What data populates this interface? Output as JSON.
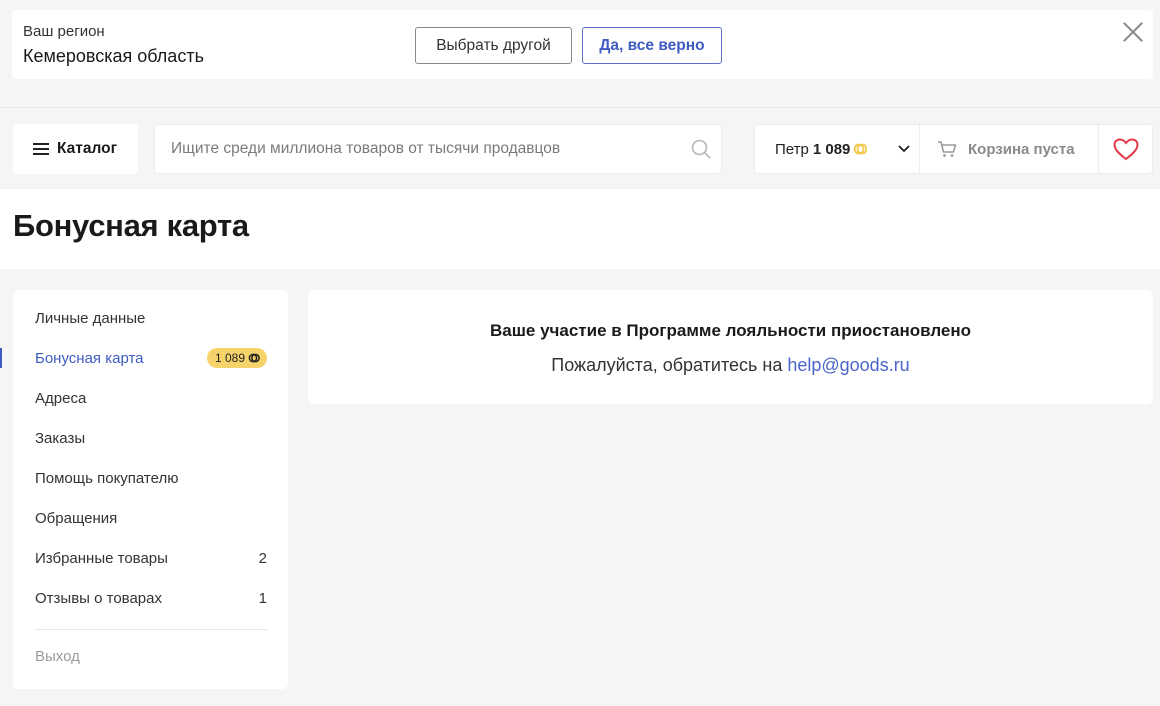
{
  "region": {
    "label": "Ваш регион",
    "name": "Кемеровская область",
    "choose_other": "Выбрать другой",
    "confirm": "Да, все верно"
  },
  "header": {
    "catalog_label": "Каталог",
    "search_placeholder": "Ищите среди миллиона товаров от тысячи продавцов",
    "user_name": "Петр",
    "user_points": "1 089",
    "cart_label": "Корзина пуста"
  },
  "page": {
    "title": "Бонусная карта"
  },
  "sidebar": {
    "items": [
      {
        "label": "Личные данные",
        "extra": ""
      },
      {
        "label": "Бонусная карта",
        "extra": "1 089"
      },
      {
        "label": "Адреса",
        "extra": ""
      },
      {
        "label": "Заказы",
        "extra": ""
      },
      {
        "label": "Помощь покупателю",
        "extra": ""
      },
      {
        "label": "Обращения",
        "extra": ""
      },
      {
        "label": "Избранные товары",
        "extra": "2"
      },
      {
        "label": "Отзывы о товарах",
        "extra": "1"
      }
    ],
    "logout": "Выход"
  },
  "main": {
    "message_title": "Ваше участие в Программе лояльности приостановлено",
    "message_text": "Пожалуйста, обратитесь на ",
    "email": "help@goods.ru"
  },
  "colors": {
    "accent": "#3f5bc2",
    "badge": "#f7d46b",
    "heart": "#e23b4a"
  }
}
